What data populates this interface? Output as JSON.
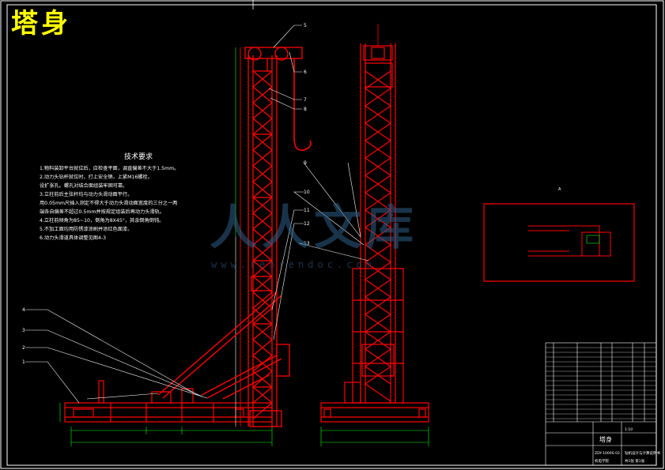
{
  "drawing": {
    "title": "塔身",
    "colors": {
      "background": "#000000",
      "frame": "#ffffff",
      "structure": "#ff0000",
      "dimension": "#00ff00",
      "leader": "#ffffff",
      "title": "#ffff00",
      "watermark": "#2f5f87"
    }
  },
  "notes": {
    "title": "技术要求",
    "lines": [
      "1.物料装卸平台就位后，应检查平面，调直偏差不大于1.5mm。",
      "2.动力头钻杆就位时，打上安全销，上紧M16螺栓。",
      "  设扩张孔。螺孔对结合面组装牢固可靠。",
      "3.立柱前后主弦杆均与动力头滑动面平行。",
      "  用0.05mm尺插入测定不得大于动力头滑动面宽度的三分之一两",
      "  端各自偏差不超过0.5mm并按规定组装后再动力头滑轨。",
      "4.立柱前倾角为85~10，倒角为8X45°，其余倒角倒钝。",
      "5.不加工面均用防锈漆涂刷并涂红色面漆。",
      "6.动力头滑道具体调整见图4-3"
    ]
  },
  "balloons": [
    "5",
    "6",
    "7",
    "8",
    "9",
    "10",
    "11",
    "12",
    "13",
    "4",
    "3",
    "2",
    "1"
  ],
  "section_label": "A",
  "watermark": {
    "text": "人人文库",
    "url": "www.renrendoc.com"
  },
  "title_block": {
    "part_name": "塔身",
    "drawing_no": "ZDY-1000S-03",
    "project": "钻机设计与计算说明书",
    "school": "机电学院",
    "scale": "1:10",
    "sheet_label": "共1张 第1张"
  }
}
